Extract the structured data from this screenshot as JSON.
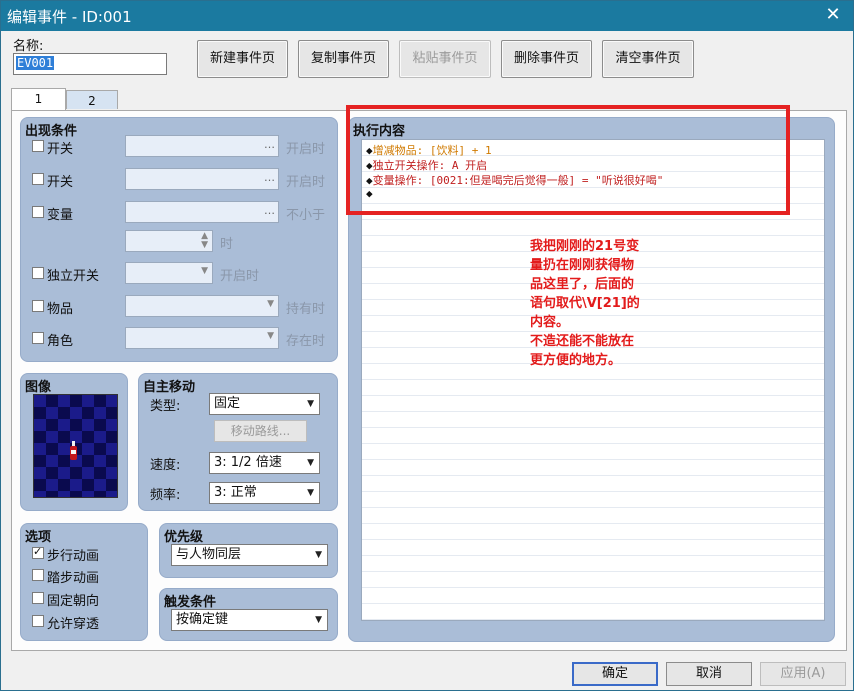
{
  "window": {
    "title": "编辑事件 - ID:001",
    "close_glyph": "✕"
  },
  "name": {
    "label": "名称:",
    "value": "EV001"
  },
  "toolbar": {
    "new_page": "新建事件页",
    "copy_page": "复制事件页",
    "paste_page": "粘贴事件页",
    "delete_page": "删除事件页",
    "clear_page": "清空事件页"
  },
  "tabs": [
    {
      "label": "1"
    },
    {
      "label": "2"
    }
  ],
  "conditions": {
    "title": "出现条件",
    "rows": [
      {
        "label": "开关",
        "suffix": "开启时"
      },
      {
        "label": "开关",
        "suffix": "开启时"
      },
      {
        "label": "变量",
        "suffix": "不小于"
      },
      {
        "label": "",
        "suffix": "时"
      },
      {
        "label": "独立开关",
        "suffix": "开启时"
      },
      {
        "label": "物品",
        "suffix": "持有时"
      },
      {
        "label": "角色",
        "suffix": "存在时"
      }
    ]
  },
  "image": {
    "title": "图像"
  },
  "movement": {
    "title": "自主移动",
    "type_label": "类型:",
    "type_value": "固定",
    "route_button": "移动路线...",
    "speed_label": "速度:",
    "speed_value": "3: 1/2 倍速",
    "freq_label": "频率:",
    "freq_value": "3: 正常"
  },
  "options": {
    "title": "选项",
    "items": [
      {
        "label": "步行动画",
        "checked": true
      },
      {
        "label": "踏步动画",
        "checked": false
      },
      {
        "label": "固定朝向",
        "checked": false
      },
      {
        "label": "允许穿透",
        "checked": false
      }
    ]
  },
  "priority": {
    "title": "优先级",
    "value": "与人物同层"
  },
  "trigger": {
    "title": "触发条件",
    "value": "按确定键"
  },
  "contents": {
    "title": "执行内容",
    "lines": [
      {
        "marker": "◆",
        "text": "增减物品: [饮料] + 1"
      },
      {
        "marker": "◆",
        "text": "独立开关操作: A 开启"
      },
      {
        "marker": "◆",
        "text": "变量操作: [0021:但是喝完后觉得一般] = \"听说很好喝\""
      },
      {
        "marker": "◆",
        "text": ""
      }
    ]
  },
  "annotation": {
    "text": "我把刚刚的21号变\n量扔在刚刚获得物\n品这里了，后面的\n语句取代\\V[21]的\n内容。\n不造还能不能放在\n更方便的地方。",
    "color": "#e31b1b"
  },
  "footer": {
    "ok": "确定",
    "cancel": "取消",
    "apply": "应用(A)"
  }
}
